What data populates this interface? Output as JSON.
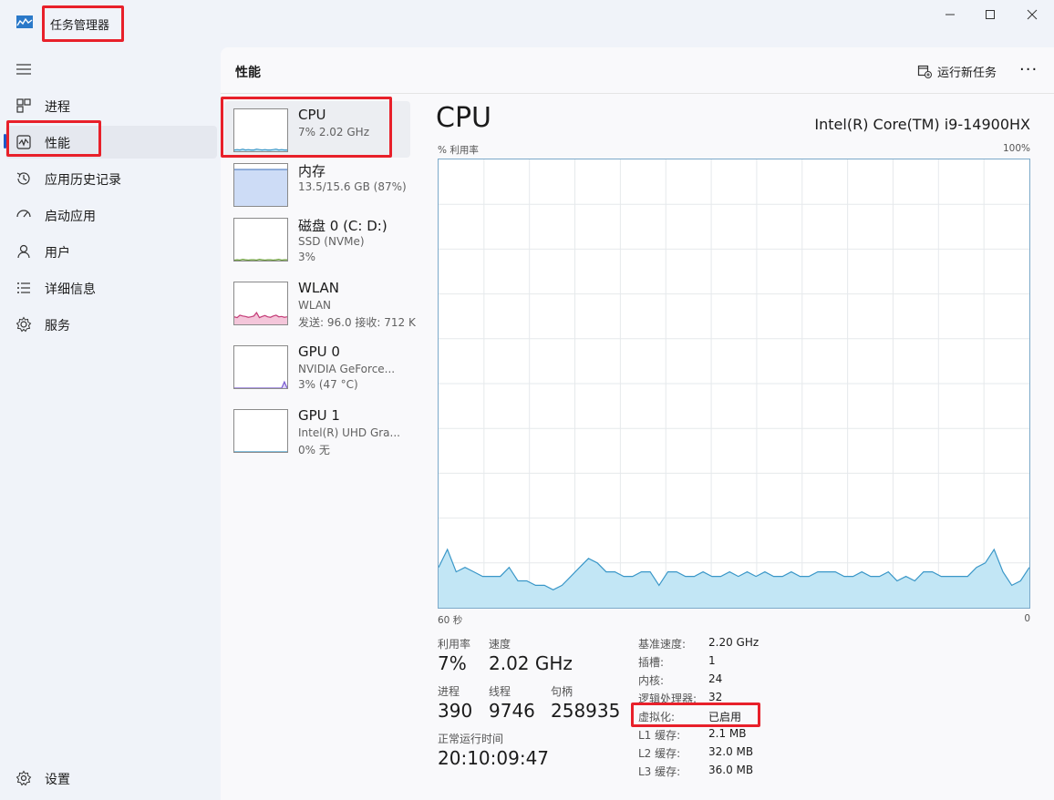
{
  "window": {
    "title": "任务管理器",
    "controls": [
      "minimize",
      "maximize",
      "close"
    ]
  },
  "sidebar": {
    "items": [
      {
        "label": "进程",
        "icon": "processes-icon"
      },
      {
        "label": "性能",
        "icon": "performance-icon",
        "active": true
      },
      {
        "label": "应用历史记录",
        "icon": "app-history-icon"
      },
      {
        "label": "启动应用",
        "icon": "startup-apps-icon"
      },
      {
        "label": "用户",
        "icon": "users-icon"
      },
      {
        "label": "详细信息",
        "icon": "details-icon"
      },
      {
        "label": "服务",
        "icon": "services-icon"
      }
    ],
    "settings_label": "设置"
  },
  "header": {
    "title": "性能",
    "run_task_label": "运行新任务",
    "more_label": "···"
  },
  "devices": [
    {
      "name": "CPU",
      "lines": [
        "7% 2.02 GHz"
      ],
      "selected": true
    },
    {
      "name": "内存",
      "lines": [
        "13.5/15.6 GB (87%)"
      ]
    },
    {
      "name": "磁盘 0 (C: D:)",
      "lines": [
        "SSD (NVMe)",
        "3%"
      ]
    },
    {
      "name": "WLAN",
      "lines": [
        "WLAN",
        "发送: 96.0 接收: 712 K"
      ]
    },
    {
      "name": "GPU 0",
      "lines": [
        "NVIDIA GeForce...",
        "3% (47 °C)"
      ]
    },
    {
      "name": "GPU 1",
      "lines": [
        "Intel(R) UHD Gra...",
        "0% 无"
      ]
    }
  ],
  "detail": {
    "title": "CPU",
    "model": "Intel(R) Core(TM) i9-14900HX",
    "graph_label": "% 利用率",
    "graph_max": "100%",
    "time_left": "60 秒",
    "time_right": "0",
    "utilization_label": "利用率",
    "utilization": "7%",
    "speed_label": "速度",
    "speed": "2.02 GHz",
    "processes_label": "进程",
    "processes": "390",
    "threads_label": "线程",
    "threads": "9746",
    "handles_label": "句柄",
    "handles": "258935",
    "uptime_label": "正常运行时间",
    "uptime": "20:10:09:47",
    "specs": [
      {
        "label": "基准速度:",
        "value": "2.20 GHz"
      },
      {
        "label": "插槽:",
        "value": "1"
      },
      {
        "label": "内核:",
        "value": "24"
      },
      {
        "label": "逻辑处理器:",
        "value": "32"
      },
      {
        "label": "虚拟化:",
        "value": "已启用"
      },
      {
        "label": "L1 缓存:",
        "value": "2.1 MB"
      },
      {
        "label": "L2 缓存:",
        "value": "32.0 MB"
      },
      {
        "label": "L3 缓存:",
        "value": "36.0 MB"
      }
    ]
  },
  "chart_data": {
    "type": "area",
    "ylim": [
      0,
      100
    ],
    "values": [
      9,
      13,
      8,
      9,
      8,
      7,
      7,
      7,
      9,
      6,
      6,
      5,
      5,
      4,
      5,
      7,
      9,
      11,
      10,
      8,
      8,
      7,
      7,
      8,
      8,
      5,
      8,
      8,
      7,
      7,
      8,
      7,
      7,
      8,
      7,
      8,
      7,
      8,
      7,
      7,
      8,
      7,
      7,
      8,
      8,
      8,
      7,
      7,
      8,
      7,
      7,
      8,
      6,
      7,
      6,
      8,
      8,
      7,
      7,
      7,
      7,
      9,
      10,
      13,
      8,
      5,
      6,
      9
    ],
    "colors": {
      "line": "#3a97c8",
      "fill": "#c2e6f5",
      "grid": "#e6e9ec"
    }
  },
  "mini_charts": {
    "cpu": {
      "values": [
        3,
        4,
        3,
        5,
        3,
        4,
        3,
        3,
        5,
        4,
        3,
        4,
        3,
        3,
        4,
        5,
        3,
        4,
        3,
        3
      ],
      "line": "#3a97c8",
      "fill": "#c2e6f5"
    },
    "memory": {
      "values": [
        87,
        87,
        87,
        87,
        87,
        87,
        87,
        87,
        87,
        87,
        87,
        87,
        87,
        87,
        87,
        87,
        87,
        87,
        87,
        87
      ],
      "line": "#5d87c7",
      "fill": "#cddcf6"
    },
    "disk": {
      "values": [
        1,
        2,
        1,
        3,
        2,
        1,
        2,
        2,
        1,
        3,
        2,
        1,
        2,
        2,
        1,
        2,
        3,
        1,
        2,
        2
      ],
      "line": "#6b9b3b",
      "fill": "#d6edc4"
    },
    "wlan": {
      "values": [
        18,
        16,
        22,
        20,
        19,
        17,
        18,
        20,
        28,
        16,
        19,
        21,
        18,
        17,
        20,
        22,
        18,
        19,
        17,
        18
      ],
      "line": "#c43c77",
      "fill": "#f4c6da"
    },
    "gpu0": {
      "values": [
        0,
        0,
        0,
        0,
        0,
        0,
        0,
        0,
        0,
        0,
        0,
        0,
        0,
        0,
        0,
        0,
        0,
        0,
        15,
        0
      ],
      "line": "#7a5cd1",
      "fill": "#dcd2f6"
    },
    "gpu1": {
      "values": [
        0,
        0,
        0,
        0,
        0,
        0,
        0,
        0,
        0,
        0,
        0,
        0,
        0,
        0,
        0,
        0,
        0,
        0,
        0,
        0
      ],
      "line": "#3a97c8",
      "fill": "#c2e6f5"
    }
  }
}
